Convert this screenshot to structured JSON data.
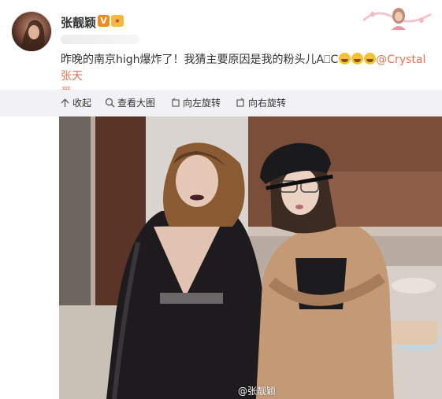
{
  "post": {
    "username": "张靓颖",
    "verified_badge": "V",
    "text_main": "昨晚的南京high爆炸了！我猜主要原因是我的粉头儿A⎕C",
    "mention": "@Crystal张天",
    "text_tail": "爱",
    "emojis": [
      "laugh-cry-emoji",
      "laugh-cry-emoji",
      "laugh-cry-emoji"
    ]
  },
  "toolbar": {
    "collapse_label": "收起",
    "view_large_label": "查看大图",
    "rotate_left_label": "向左旋转",
    "rotate_right_label": "向右旋转"
  },
  "photo": {
    "watermark": "@张靓颖"
  },
  "colors": {
    "mention": "#eb7350",
    "toolbar_bg": "#f2f2f5",
    "verified": "#f08c1a"
  }
}
